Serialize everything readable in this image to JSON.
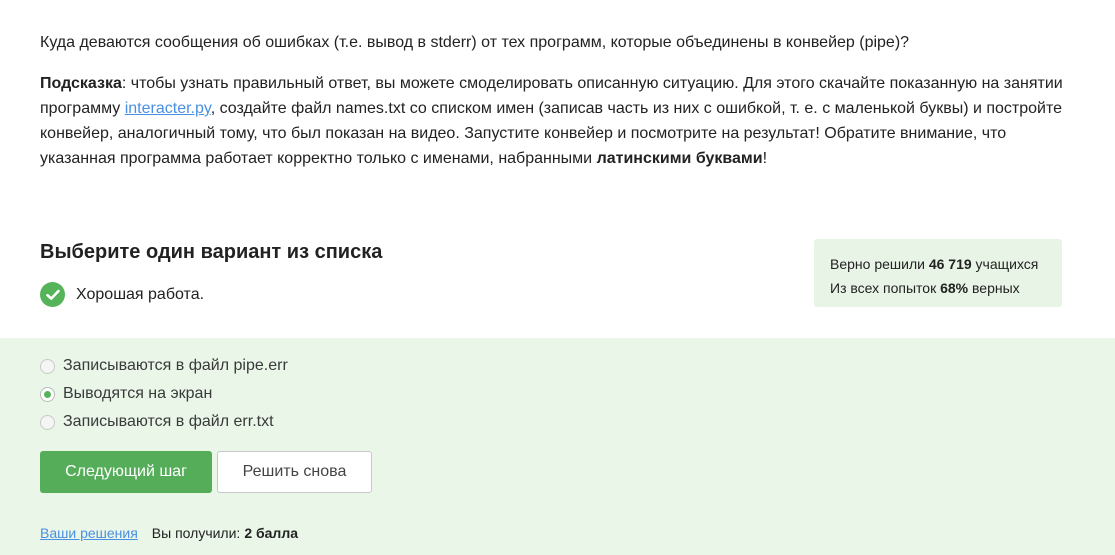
{
  "question": {
    "text": "Куда деваются сообщения об ошибках (т.е. вывод в stderr) от тех программ, которые объединены в конвейер (pipe)?",
    "hint_label": "Подсказка",
    "hint_part1": ": чтобы узнать правильный ответ, вы можете смоделировать описанную ситуацию. Для этого скачайте показанную на занятии программу ",
    "hint_link": "interacter.py",
    "hint_part2": ", создайте файл names.txt со списком имен (записав часть из них с ошибкой, т. е. с маленькой буквы) и постройте конвейер, аналогичный тому, что был показан на видео. Запустите конвейер и посмотрите на результат! Обратите внимание, что указанная программа работает корректно только с именами, набранными ",
    "hint_bold": "латинскими буквами",
    "hint_end": "!"
  },
  "quiz": {
    "title": "Выберите один вариант из списка",
    "feedback": "Хорошая работа.",
    "options": [
      {
        "label": "Записываются в файл pipe.err",
        "checked": false
      },
      {
        "label": "Выводятся на экран",
        "checked": true
      },
      {
        "label": "Записываются в файл err.txt",
        "checked": false
      }
    ],
    "next_button": "Следующий шаг",
    "retry_button": "Решить снова"
  },
  "stats": {
    "line1_prefix": "Верно решили",
    "solved_count": "46 719",
    "line1_suffix": "учащихся",
    "line2_prefix": "Из всех попыток",
    "percent": "68%",
    "line2_suffix": "верных"
  },
  "footer": {
    "solutions_link": "Ваши решения",
    "score_prefix": "Вы получили:",
    "score_value": "2 балла"
  },
  "colors": {
    "accent_green": "#55ad59",
    "link_blue": "#4a90e2",
    "answer_bg": "#e9f6e8",
    "stats_bg": "#e8f5e6"
  },
  "icons": {
    "feedback": "check-circle-icon",
    "radio": "radio-icon"
  }
}
